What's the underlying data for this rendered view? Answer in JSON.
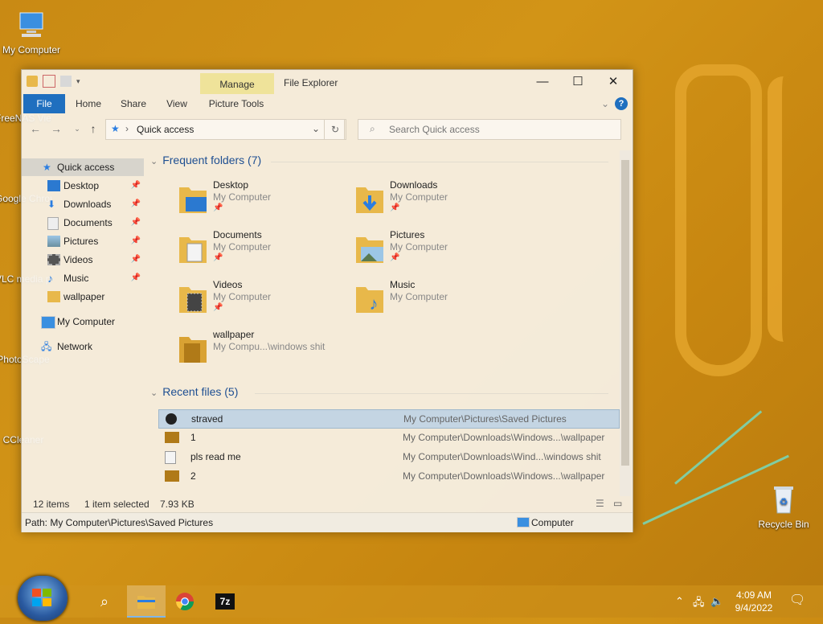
{
  "desktop": {
    "icons": [
      {
        "label": "My Computer"
      },
      {
        "label": "FreeNAS Viewer"
      },
      {
        "label": "Google Chrome"
      },
      {
        "label": "VLC media player"
      },
      {
        "label": "PhotoScape"
      },
      {
        "label": "CCleaner"
      },
      {
        "label": "Recycle Bin"
      }
    ]
  },
  "explorer": {
    "title": "File Explorer",
    "contextual_tab": "Manage",
    "ribbon_tabs": [
      "File",
      "Home",
      "Share",
      "View",
      "Picture Tools"
    ],
    "address": "Quick access",
    "search_placeholder": "Search Quick access",
    "nav": {
      "quick_access": "Quick access",
      "items": [
        "Desktop",
        "Downloads",
        "Documents",
        "Pictures",
        "Videos",
        "Music",
        "wallpaper"
      ],
      "my_computer": "My Computer",
      "network": "Network"
    },
    "frequent": {
      "header": "Frequent folders (7)",
      "folders": [
        {
          "name": "Desktop",
          "location": "My Computer"
        },
        {
          "name": "Downloads",
          "location": "My Computer"
        },
        {
          "name": "Documents",
          "location": "My Computer"
        },
        {
          "name": "Pictures",
          "location": "My Computer"
        },
        {
          "name": "Videos",
          "location": "My Computer"
        },
        {
          "name": "Music",
          "location": "My Computer"
        },
        {
          "name": "wallpaper",
          "location": "My Compu...\\windows shit"
        }
      ]
    },
    "recent": {
      "header": "Recent files (5)",
      "files": [
        {
          "name": "straved",
          "path": "My Computer\\Pictures\\Saved Pictures"
        },
        {
          "name": "1",
          "path": "My Computer\\Downloads\\Windows...\\wallpaper"
        },
        {
          "name": "pls read me",
          "path": "My Computer\\Downloads\\Wind...\\windows shit"
        },
        {
          "name": "2",
          "path": "My Computer\\Downloads\\Windows...\\wallpaper"
        }
      ]
    },
    "status": {
      "items": "12 items",
      "selected": "1 item selected",
      "size": "7.93 KB"
    },
    "pathbar": {
      "path": "Path: My Computer\\Pictures\\Saved Pictures",
      "location": "Computer"
    }
  },
  "taskbar": {
    "time": "4:09 AM",
    "date": "9/4/2022"
  },
  "colors": {
    "accent": "#1f6fbf",
    "desktop": "#c98a14",
    "manage_tab": "#efe39a"
  }
}
